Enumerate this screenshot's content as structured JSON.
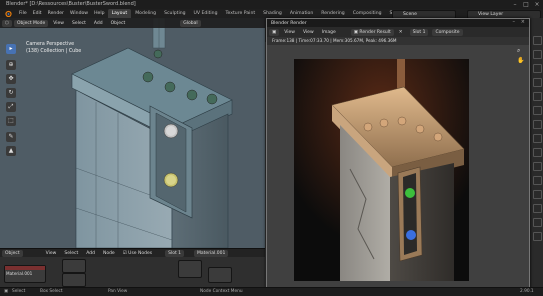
{
  "window": {
    "title": "Blender* [D:\\Ressources\\Buster\\BusterSword.blend]"
  },
  "menu": [
    "File",
    "Edit",
    "Render",
    "Window",
    "Help"
  ],
  "workspaces": [
    "Layout",
    "Modeling",
    "Sculpting",
    "UV Editing",
    "Texture Paint",
    "Shading",
    "Animation",
    "Rendering",
    "Compositing",
    "Scripting"
  ],
  "active_workspace": "Layout",
  "scene": {
    "label": "Scene",
    "view_layer": "View Layer"
  },
  "viewport": {
    "mode": "Object Mode",
    "menu": [
      "View",
      "Select",
      "Add",
      "Object"
    ],
    "orientation": "Global",
    "info_line1": "Camera Perspective",
    "info_line2": "(138) Collection | Cube"
  },
  "node_editor": {
    "type_label": "Object",
    "menu": [
      "View",
      "Select",
      "Add",
      "Node"
    ],
    "use_nodes": "Use Nodes",
    "slot": "Slot 1",
    "material": "Material.001",
    "node_label": "Material.001"
  },
  "render_window": {
    "title": "Blender Render",
    "menu": [
      "View",
      "View",
      "Image"
    ],
    "result": "Render Result",
    "slot": "Slot 1",
    "layer": "Composite",
    "info": "Frame:138 | Time:07:33.70 | Mem:305.67M, Peak: 496.36M"
  },
  "status": {
    "select": "Select",
    "box_select": "Box Select",
    "pan_view": "Pan View",
    "context_menu": "Node Context Menu",
    "version": "2.90.1"
  },
  "colors": {
    "accent": "#4772b3",
    "active_tab": "#3d3d3d",
    "gem_green": "#3cbf3c",
    "gem_blue": "#3a6fe0"
  }
}
